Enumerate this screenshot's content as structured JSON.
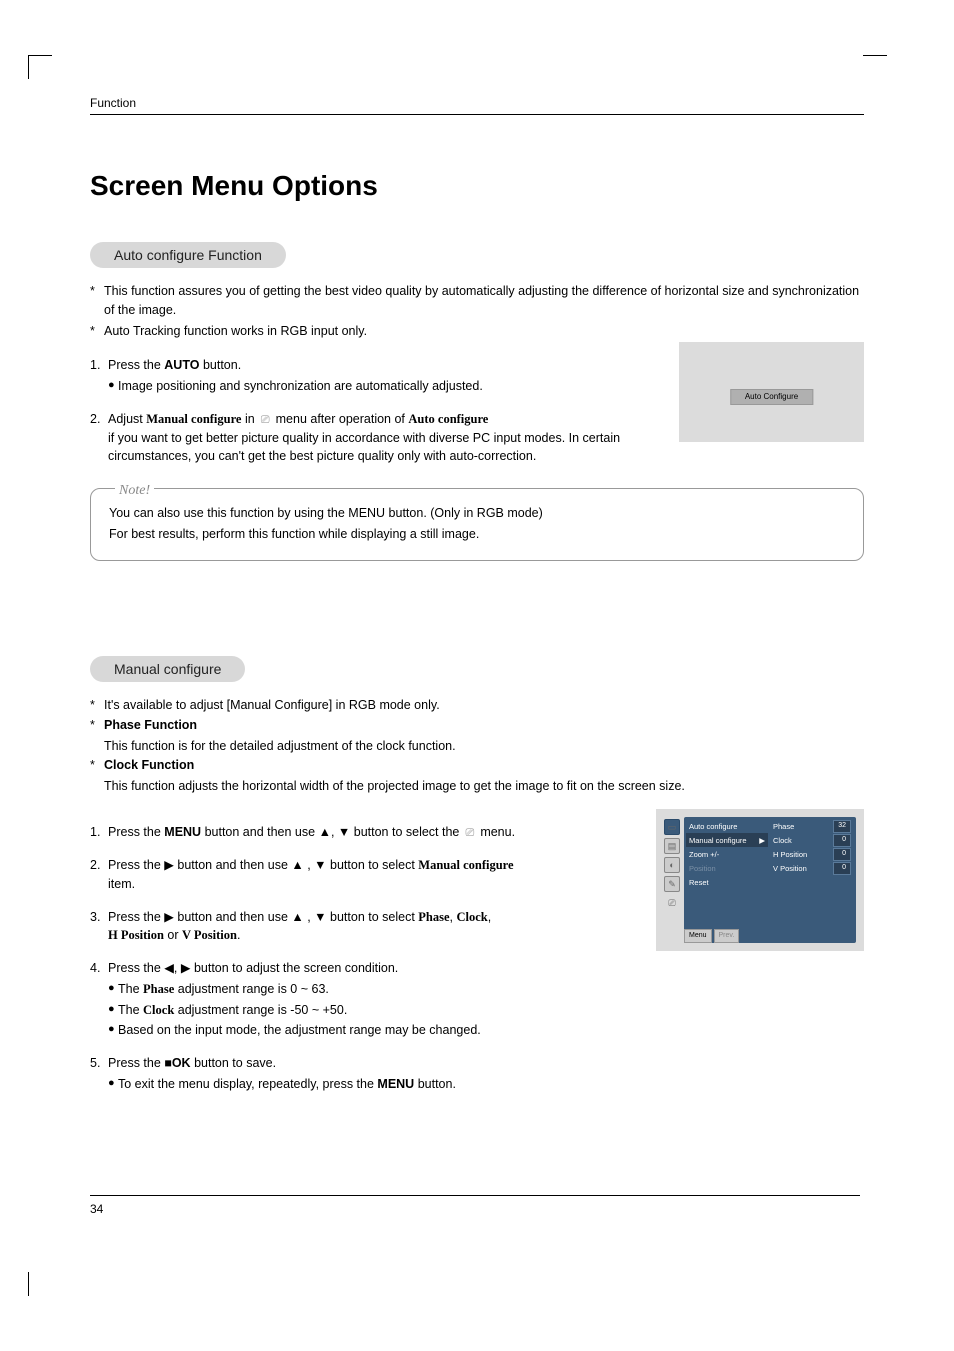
{
  "header": "Function",
  "title": "Screen Menu Options",
  "page_number": "34",
  "section1": {
    "pill": "Auto configure Function",
    "p1": "This function assures you of getting the best video quality by automatically adjusting the difference of horizontal size and synchronization of the image.",
    "p2": "Auto Tracking function works in RGB input only.",
    "step1_prefix": "Press the ",
    "step1_bold": "AUTO",
    "step1_suffix": " button.",
    "step1_bullet": "Image positioning and synchronization are automatically adjusted.",
    "step2_a": "Adjust ",
    "step2_mc": "Manual configure",
    "step2_b": " in ",
    "step2_c": " menu after operation of ",
    "step2_ac": "Auto configure",
    "step2_tail": "if you want to get better picture quality in accordance with diverse PC input modes. In certain circumstances, you can't get the best picture quality only with auto-correction.",
    "image_label": "Auto Configure",
    "note_label": "Note!",
    "note_line1": "You can also use this function by using the MENU button. (Only in RGB mode)",
    "note_line2": "For best results, perform this function while displaying a still image."
  },
  "section2": {
    "pill": "Manual configure",
    "p1": "It's available to adjust [Manual Configure] in RGB mode only.",
    "p2_label": "Phase Function",
    "p2_desc": "This function is for the detailed adjustment of the clock function.",
    "p3_label": "Clock Function",
    "p3_desc": "This function adjusts the horizontal width of the projected image to get the image to fit on the screen size.",
    "step1_a": "Press the ",
    "step1_menu": "MENU",
    "step1_b": " button and then use ",
    "step1_c": " button to select the ",
    "step1_d": " menu.",
    "step2_a": "Press the ",
    "step2_b": " button and then use ",
    "step2_c": " button to select ",
    "step2_mc": "Manual configure",
    "step2_d": "item.",
    "step3_a": "Press the ",
    "step3_b": " button and then use ",
    "step3_c": " button to select ",
    "step3_phase": "Phase",
    "step3_clock": "Clock",
    "step3_hpos": "H Position",
    "step3_or": " or ",
    "step3_vpos": "V Position",
    "step4_a": "Press the ",
    "step4_b": " button to adjust the screen condition.",
    "step4_bullet1_a": "The ",
    "step4_b1_phase": "Phase",
    "step4_bullet1_b": " adjustment range is 0 ~ 63.",
    "step4_bullet2_a": "The ",
    "step4_b2_clock": "Clock",
    "step4_bullet2_b": " adjustment range is -50 ~ +50.",
    "step4_bullet3": "Based on the input mode, the adjustment range may be changed.",
    "step5_a": "Press the ",
    "step5_ok": "■OK",
    "step5_b": " button to save.",
    "step5_bullet_a": "To exit the menu display, repeatedly, press the ",
    "step5_menu": "MENU",
    "step5_bullet_b": " button.",
    "osd": {
      "items": [
        "Auto configure",
        "Manual configure",
        "Zoom +/-",
        "Position",
        "Reset"
      ],
      "right": [
        {
          "label": "Phase",
          "val": "32"
        },
        {
          "label": "Clock",
          "val": "0"
        },
        {
          "label": "H Position",
          "val": "0"
        },
        {
          "label": "V Position",
          "val": "0"
        }
      ],
      "footer1": "Menu",
      "footer2": "Prev."
    }
  },
  "glyphs": {
    "up": "▲",
    "down": "▼",
    "left": "◀",
    "right": "▶",
    "arrow_r": "▶",
    "screen": "⎚"
  }
}
